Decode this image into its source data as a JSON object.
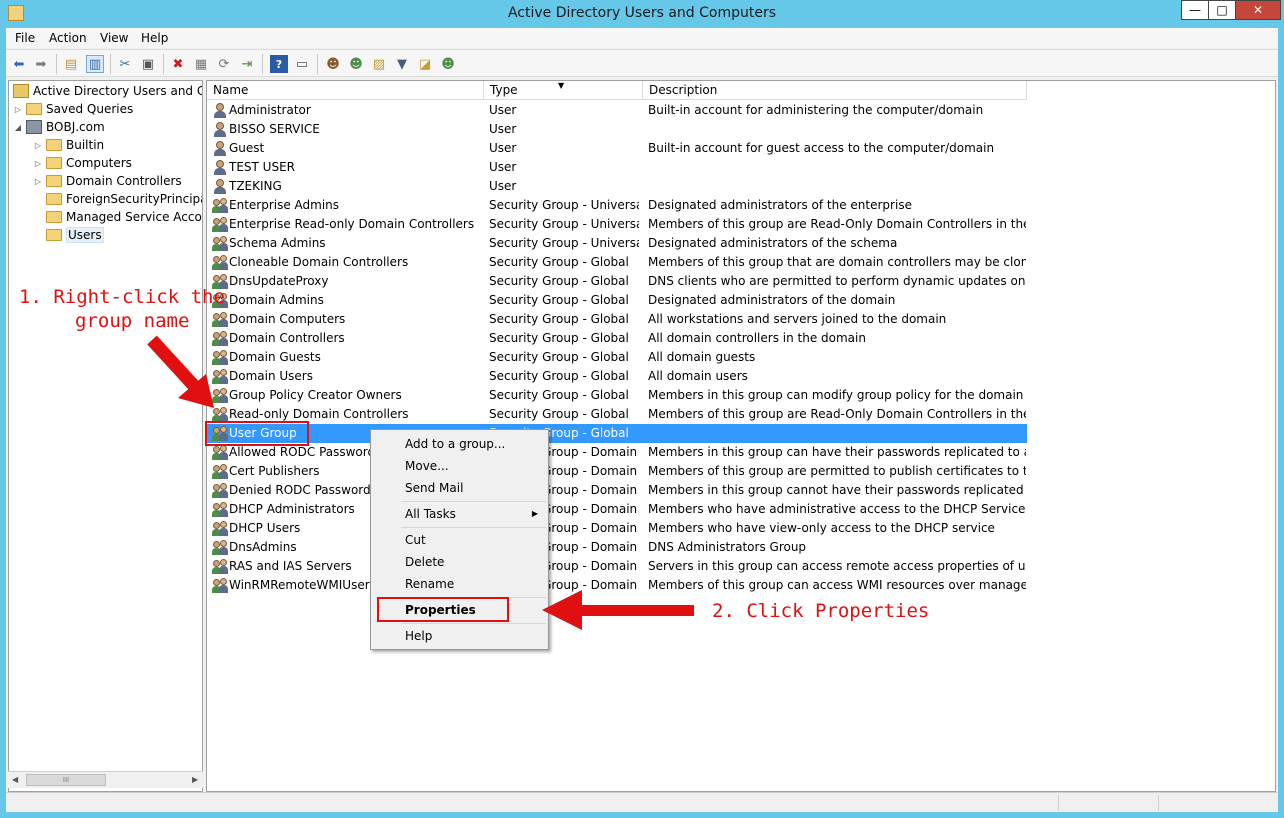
{
  "window": {
    "title": "Active Directory Users and Computers",
    "min_glyph": "—",
    "max_glyph": "□",
    "close_glyph": "✕"
  },
  "menu": [
    "File",
    "Action",
    "View",
    "Help"
  ],
  "toolbar": [
    "back-icon",
    "forward-icon",
    "up-folder-icon",
    "show-hide-tree-icon",
    "cut-icon",
    "copy-icon",
    "delete-icon",
    "properties-icon",
    "refresh-icon",
    "export-list-icon",
    "help-icon",
    "console-icon",
    "new-user-icon",
    "new-group-icon",
    "new-ou-icon",
    "filter-icon",
    "find-icon",
    "add-to-group-icon"
  ],
  "tree": {
    "root": "Active Directory Users and Com",
    "items": [
      {
        "label": "Saved Queries",
        "indent": 1,
        "expander": "▷"
      },
      {
        "label": "BOBJ.com",
        "indent": 1,
        "expander": "◢"
      },
      {
        "label": "Builtin",
        "indent": 2,
        "expander": "▷"
      },
      {
        "label": "Computers",
        "indent": 2,
        "expander": "▷"
      },
      {
        "label": "Domain Controllers",
        "indent": 2,
        "expander": "▷"
      },
      {
        "label": "ForeignSecurityPrincipals",
        "indent": 2,
        "expander": ""
      },
      {
        "label": "Managed Service Accour",
        "indent": 2,
        "expander": ""
      },
      {
        "label": "Users",
        "indent": 2,
        "expander": "",
        "selected": true
      }
    ],
    "scroll_thumb": "III"
  },
  "list": {
    "columns": {
      "name": "Name",
      "type": "Type",
      "description": "Description"
    },
    "rows": [
      {
        "name": "Administrator",
        "type": "User",
        "description": "Built-in account for administering the computer/domain",
        "kind": "user"
      },
      {
        "name": "BISSO SERVICE",
        "type": "User",
        "description": "",
        "kind": "user"
      },
      {
        "name": "Guest",
        "type": "User",
        "description": "Built-in account for guest access to the computer/domain",
        "kind": "user"
      },
      {
        "name": "TEST USER",
        "type": "User",
        "description": "",
        "kind": "user"
      },
      {
        "name": "TZEKING",
        "type": "User",
        "description": "",
        "kind": "user"
      },
      {
        "name": "Enterprise Admins",
        "type": "Security Group - Universal",
        "description": "Designated administrators of the enterprise",
        "kind": "group"
      },
      {
        "name": "Enterprise Read-only Domain Controllers",
        "type": "Security Group - Universal",
        "description": "Members of this group are Read-Only Domain Controllers in the ente...",
        "kind": "group"
      },
      {
        "name": "Schema Admins",
        "type": "Security Group - Universal",
        "description": "Designated administrators of the schema",
        "kind": "group"
      },
      {
        "name": "Cloneable Domain Controllers",
        "type": "Security Group - Global",
        "description": "Members of this group that are domain controllers may be cloned.",
        "kind": "group"
      },
      {
        "name": "DnsUpdateProxy",
        "type": "Security Group - Global",
        "description": "DNS clients who are permitted to perform dynamic updates on behal...",
        "kind": "group"
      },
      {
        "name": "Domain Admins",
        "type": "Security Group - Global",
        "description": "Designated administrators of the domain",
        "kind": "group"
      },
      {
        "name": "Domain Computers",
        "type": "Security Group - Global",
        "description": "All workstations and servers joined to the domain",
        "kind": "group"
      },
      {
        "name": "Domain Controllers",
        "type": "Security Group - Global",
        "description": "All domain controllers in the domain",
        "kind": "group"
      },
      {
        "name": "Domain Guests",
        "type": "Security Group - Global",
        "description": "All domain guests",
        "kind": "group"
      },
      {
        "name": "Domain Users",
        "type": "Security Group - Global",
        "description": "All domain users",
        "kind": "group"
      },
      {
        "name": "Group Policy Creator Owners",
        "type": "Security Group - Global",
        "description": "Members in this group can modify group policy for the domain",
        "kind": "group"
      },
      {
        "name": "Read-only Domain Controllers",
        "type": "Security Group - Global",
        "description": "Members of this group are Read-Only Domain Controllers in the do...",
        "kind": "group"
      },
      {
        "name": "User Group",
        "type": "Security Group - Global",
        "description": "",
        "kind": "group",
        "selected": true
      },
      {
        "name": "Allowed RODC Password Re",
        "type": "Security Group - Domain ...",
        "description": "Members in this group can have their passwords replicated to all rea...",
        "kind": "group"
      },
      {
        "name": "Cert Publishers",
        "type": "Security Group - Domain ...",
        "description": "Members of this group are permitted to publish certificates to the dir...",
        "kind": "group"
      },
      {
        "name": "Denied RODC Password Re",
        "type": "Security Group - Domain ...",
        "description": "Members in this group cannot have their passwords replicated to any...",
        "kind": "group"
      },
      {
        "name": "DHCP Administrators",
        "type": "Security Group - Domain ...",
        "description": "Members who have administrative access to the DHCP Service",
        "kind": "group"
      },
      {
        "name": "DHCP Users",
        "type": "Security Group - Domain ...",
        "description": "Members who have view-only access to the DHCP service",
        "kind": "group"
      },
      {
        "name": "DnsAdmins",
        "type": "Security Group - Domain ...",
        "description": "DNS Administrators Group",
        "kind": "group"
      },
      {
        "name": "RAS and IAS Servers",
        "type": "Security Group - Domain ...",
        "description": "Servers in this group can access remote access properties of users",
        "kind": "group"
      },
      {
        "name": "WinRMRemoteWMIUsers_",
        "type": "Security Group - Domain ...",
        "description": "Members of this group can access WMI resources over management ...",
        "kind": "group"
      }
    ]
  },
  "context_menu": {
    "items": [
      {
        "label": "Add to a group...",
        "type": "item"
      },
      {
        "label": "Move...",
        "type": "item"
      },
      {
        "label": "Send Mail",
        "type": "item"
      },
      {
        "type": "sep"
      },
      {
        "label": "All Tasks",
        "type": "submenu"
      },
      {
        "type": "sep"
      },
      {
        "label": "Cut",
        "type": "item"
      },
      {
        "label": "Delete",
        "type": "item"
      },
      {
        "label": "Rename",
        "type": "item"
      },
      {
        "type": "sep"
      },
      {
        "label": "Properties",
        "type": "item",
        "bold": true
      },
      {
        "type": "sep"
      },
      {
        "label": "Help",
        "type": "item"
      }
    ]
  },
  "annotations": {
    "step1_line1": "1. Right-click the",
    "step1_line2": "group name",
    "step2": "2. Click Properties",
    "color": "#e01010"
  },
  "colors": {
    "title_bar": "#66c8e8",
    "selection": "#3399ff",
    "close_button": "#c7463a"
  }
}
